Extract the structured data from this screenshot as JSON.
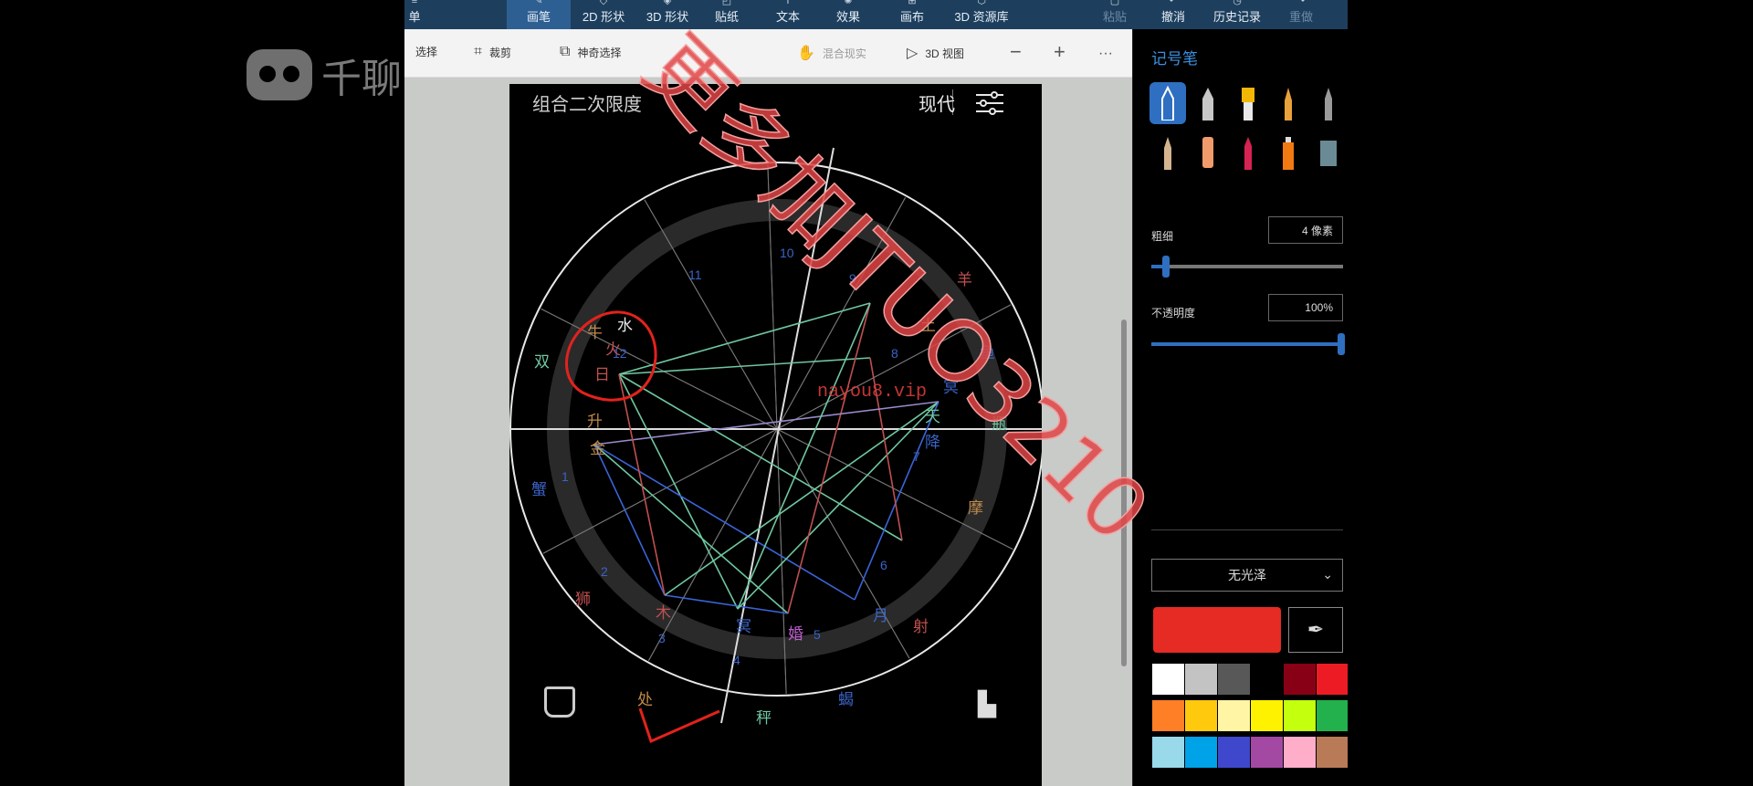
{
  "overlay_logo": {
    "text": "千聊"
  },
  "ribbon": {
    "tabs": [
      {
        "label": "单",
        "icon": "menu-icon"
      },
      {
        "label": "画笔",
        "icon": "brush-icon",
        "active": true
      },
      {
        "label": "2D 形状",
        "icon": "2d-shape-icon"
      },
      {
        "label": "3D 形状",
        "icon": "3d-shape-icon"
      },
      {
        "label": "贴纸",
        "icon": "sticker-icon"
      },
      {
        "label": "文本",
        "icon": "text-icon"
      },
      {
        "label": "效果",
        "icon": "effects-icon"
      },
      {
        "label": "画布",
        "icon": "canvas-icon"
      },
      {
        "label": "3D 资源库",
        "icon": "3d-library-icon"
      },
      {
        "label": "粘贴",
        "icon": "paste-icon",
        "dim": true
      },
      {
        "label": "撤消",
        "icon": "undo-icon"
      },
      {
        "label": "历史记录",
        "icon": "history-icon"
      },
      {
        "label": "重做",
        "icon": "redo-icon",
        "dim": true
      }
    ]
  },
  "toolbar": {
    "select": "选择",
    "crop": "裁剪",
    "magic_select": "神奇选择",
    "mixed_reality": "混合现实",
    "view_3d": "3D 视图",
    "zoom_out": "−",
    "zoom_in": "+",
    "more": "···"
  },
  "canvas": {
    "title": "组合二次限度",
    "mode": "现代",
    "settings_icon": "sliders-icon"
  },
  "chart": {
    "house_numbers": [
      "1",
      "2",
      "3",
      "4",
      "5",
      "6",
      "7",
      "8",
      "9",
      "10",
      "11",
      "12"
    ],
    "signs": [
      "牛",
      "双",
      "蟹",
      "狮",
      "处",
      "秤",
      "蝎",
      "射",
      "摩",
      "瓶",
      "鱼",
      "羊"
    ],
    "planets": [
      "水",
      "火",
      "日",
      "升",
      "金",
      "土",
      "冥",
      "天",
      "降",
      "木",
      "冥",
      "婚",
      "月"
    ],
    "watermark_url": "nayou8.vip",
    "watermark_text": "更多加JTUO3210"
  },
  "panel": {
    "title": "记号笔",
    "thickness_label": "粗细",
    "thickness_value": "4 像素",
    "opacity_label": "不透明度",
    "opacity_value": "100%",
    "texture_value": "无光泽",
    "selected_color": "#e52b24",
    "palette": [
      "#ffffff",
      "#c3c3c3",
      "#585858",
      "#000000",
      "#880015",
      "#ed1c24",
      "#ff7f27",
      "#ffc90e",
      "#fff5a5",
      "#fff200",
      "#c4ff0e",
      "#22b14c",
      "#99d9ea",
      "#00a2e8",
      "#3f48cc",
      "#a349a4",
      "#ffaec9",
      "#b97a57"
    ],
    "pen_colors": [
      "#2f6fc1",
      "#c7c7c7",
      "#f2b705",
      "#e9a23b",
      "#9a9a9a",
      "#d4b48f",
      "#f19a6b",
      "#d72352",
      "#f07a11",
      "#6a8a96"
    ]
  }
}
